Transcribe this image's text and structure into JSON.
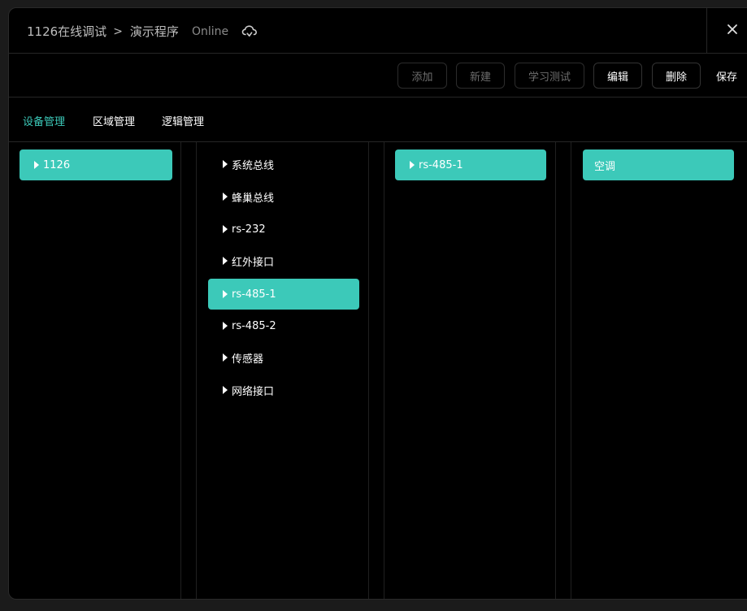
{
  "header": {
    "breadcrumb_root": "1126在线调试",
    "separator": ">",
    "breadcrumb_current": "演示程序",
    "status": "Online",
    "cloud_icon": "cloud-sync-icon",
    "close_icon": "close-icon",
    "close_glyph": "✕"
  },
  "toolbar": {
    "add_label": "添加",
    "new_label": "新建",
    "learn_test_label": "学习测试",
    "edit_label": "编辑",
    "delete_label": "删除",
    "save_label": "保存"
  },
  "tabs": [
    {
      "label": "设备管理",
      "active": true
    },
    {
      "label": "区域管理",
      "active": false
    },
    {
      "label": "逻辑管理",
      "active": false
    }
  ],
  "columns": {
    "col1": [
      {
        "label": "1126",
        "selected": true,
        "expandable": true
      }
    ],
    "col2": [
      {
        "label": "系统总线",
        "selected": false,
        "expandable": true
      },
      {
        "label": "蜂巢总线",
        "selected": false,
        "expandable": true
      },
      {
        "label": "rs-232",
        "selected": false,
        "expandable": true
      },
      {
        "label": "红外接口",
        "selected": false,
        "expandable": true
      },
      {
        "label": "rs-485-1",
        "selected": true,
        "expandable": true
      },
      {
        "label": "rs-485-2",
        "selected": false,
        "expandable": true
      },
      {
        "label": "传感器",
        "selected": false,
        "expandable": true
      },
      {
        "label": "网络接口",
        "selected": false,
        "expandable": true
      }
    ],
    "col3": [
      {
        "label": "rs-485-1",
        "selected": true,
        "expandable": true
      }
    ],
    "col4": [
      {
        "label": "空调",
        "selected": true,
        "expandable": false
      }
    ]
  },
  "colors": {
    "accent": "#3cc9b9",
    "background": "#000000",
    "text": "#ffffff",
    "muted": "#6e6e6e"
  }
}
